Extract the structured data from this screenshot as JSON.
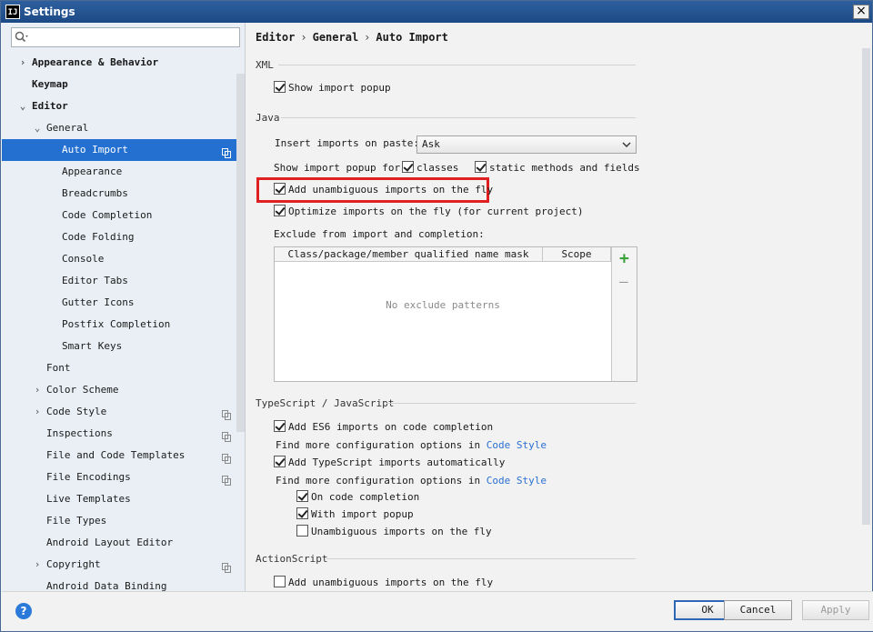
{
  "window": {
    "title": "Settings",
    "app_icon": "IJ"
  },
  "search": {
    "placeholder": ""
  },
  "tree": [
    {
      "label": "Appearance & Behavior",
      "level": 0,
      "arrow": "›",
      "bold": true
    },
    {
      "label": "Keymap",
      "level": 0,
      "arrow": "",
      "bold": true
    },
    {
      "label": "Editor",
      "level": 0,
      "arrow": "⌄",
      "bold": true
    },
    {
      "label": "General",
      "level": 1,
      "arrow": "⌄"
    },
    {
      "label": "Auto Import",
      "level": 2,
      "selected": true,
      "copy": true
    },
    {
      "label": "Appearance",
      "level": 2
    },
    {
      "label": "Breadcrumbs",
      "level": 2
    },
    {
      "label": "Code Completion",
      "level": 2
    },
    {
      "label": "Code Folding",
      "level": 2
    },
    {
      "label": "Console",
      "level": 2
    },
    {
      "label": "Editor Tabs",
      "level": 2
    },
    {
      "label": "Gutter Icons",
      "level": 2
    },
    {
      "label": "Postfix Completion",
      "level": 2
    },
    {
      "label": "Smart Keys",
      "level": 2
    },
    {
      "label": "Font",
      "level": 1
    },
    {
      "label": "Color Scheme",
      "level": 1,
      "arrow": "›"
    },
    {
      "label": "Code Style",
      "level": 1,
      "arrow": "›",
      "copy": true
    },
    {
      "label": "Inspections",
      "level": 1,
      "copy": true
    },
    {
      "label": "File and Code Templates",
      "level": 1,
      "copy": true
    },
    {
      "label": "File Encodings",
      "level": 1,
      "copy": true
    },
    {
      "label": "Live Templates",
      "level": 1
    },
    {
      "label": "File Types",
      "level": 1
    },
    {
      "label": "Android Layout Editor",
      "level": 1
    },
    {
      "label": "Copyright",
      "level": 1,
      "arrow": "›",
      "copy": true
    },
    {
      "label": "Android Data Binding",
      "level": 1
    }
  ],
  "breadcrumb": {
    "part1": "Editor",
    "part2": "General",
    "part3": "Auto Import",
    "sep": "›"
  },
  "xml": {
    "title": "XML",
    "show_import_popup": {
      "label": "Show import popup",
      "checked": true
    }
  },
  "java": {
    "title": "Java",
    "insert_label": "Insert imports on paste:",
    "insert_value": "Ask",
    "show_popup_label": "Show import popup for:",
    "classes": {
      "label": "classes",
      "checked": true
    },
    "static_methods": {
      "label": "static methods and fields",
      "checked": true
    },
    "add_unambiguous": {
      "label": "Add unambiguous imports on the fly",
      "checked": true
    },
    "optimize": {
      "label": "Optimize imports on the fly (for current project)",
      "checked": true
    },
    "exclude_label": "Exclude from import and completion:",
    "table": {
      "col1": "Class/package/member qualified name mask",
      "col2": "Scope",
      "empty": "No exclude patterns",
      "add": "+",
      "remove": "—"
    }
  },
  "ts": {
    "title": "TypeScript / JavaScript",
    "es6": {
      "label": "Add ES6 imports on code completion",
      "checked": true
    },
    "find_more_1": "Find more configuration options in",
    "code_style_link_1": "Code Style",
    "ts_auto": {
      "label": "Add TypeScript imports automatically",
      "checked": true
    },
    "find_more_2": "Find more configuration options in",
    "code_style_link_2": "Code Style",
    "on_completion": {
      "label": "On code completion",
      "checked": true
    },
    "with_popup": {
      "label": "With import popup",
      "checked": true
    },
    "unambiguous": {
      "label": "Unambiguous imports on the fly",
      "checked": false
    }
  },
  "actionscript": {
    "title": "ActionScript",
    "add_unambiguous": {
      "label": "Add unambiguous imports on the fly",
      "checked": false
    }
  },
  "footer": {
    "help": "?",
    "ok": "OK",
    "cancel": "Cancel",
    "apply": "Apply"
  },
  "colors": {
    "selection": "#2470d0",
    "link": "#2a6fd1",
    "highlight": "#e02020"
  }
}
